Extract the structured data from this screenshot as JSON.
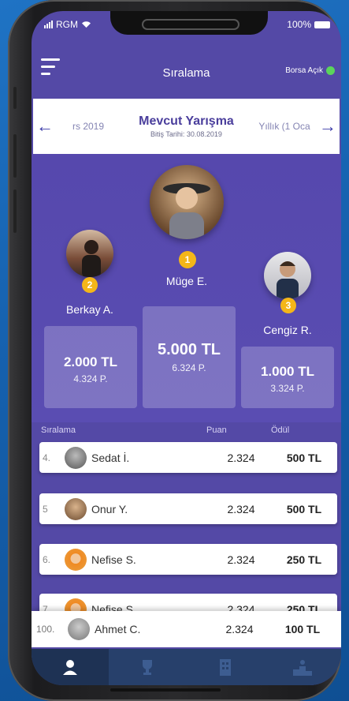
{
  "status": {
    "carrier": "RGM",
    "battery": "100%"
  },
  "header": {
    "title": "Sıralama",
    "market_label": "Borsa Açık"
  },
  "selector": {
    "prev_label": "rs 2019",
    "title": "Mevcut Yarışma",
    "subtitle": "Bitiş Tarihi: 30.08.2019",
    "next_label": "Yıllık (1 Oca"
  },
  "podium": [
    {
      "rank": "1",
      "name": "Müge E.",
      "amount": "5.000 TL",
      "points": "6.324 P."
    },
    {
      "rank": "2",
      "name": "Berkay A.",
      "amount": "2.000 TL",
      "points": "4.324 P."
    },
    {
      "rank": "3",
      "name": "Cengiz R.",
      "amount": "1.000 TL",
      "points": "3.324 P."
    }
  ],
  "table": {
    "headers": {
      "rank": "Sıralama",
      "points": "Puan",
      "prize": "Ödül"
    },
    "rows": [
      {
        "rank": "4.",
        "name": "Sedat İ.",
        "points": "2.324",
        "prize": "500 TL"
      },
      {
        "rank": "5",
        "name": "Onur Y.",
        "points": "2.324",
        "prize": "500 TL"
      },
      {
        "rank": "6.",
        "name": "Nefise S.",
        "points": "2.324",
        "prize": "250 TL"
      },
      {
        "rank": "7",
        "name": "Nefise S.",
        "points": "2.324",
        "prize": "250 TL"
      }
    ],
    "current_user": {
      "rank": "100.",
      "name": "Ahmet C.",
      "points": "2.324",
      "prize": "100 TL"
    }
  },
  "tabs": [
    "user-icon",
    "trophy-icon",
    "building-icon",
    "podium-icon"
  ],
  "colors": {
    "primary": "#5449a6",
    "accent": "#f4b619",
    "tabbar": "#27406b",
    "online": "#5bd45b"
  }
}
